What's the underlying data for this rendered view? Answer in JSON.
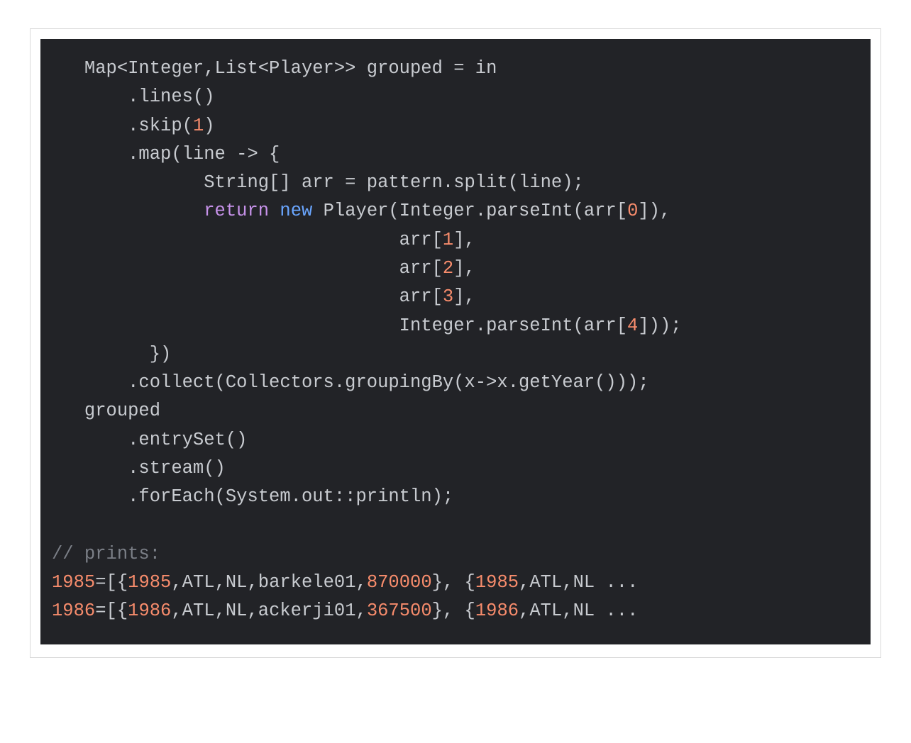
{
  "code": {
    "l1a": "   Map<Integer,List<Player>> grouped = in",
    "l2a": "       .lines()",
    "l3a": "       .skip(",
    "l3n": "1",
    "l3b": ")",
    "l4a": "       .map(line -> {",
    "l5a": "              String[] arr = pattern.split(line);",
    "l6a": "              ",
    "l6kw_return": "return",
    "l6sp": " ",
    "l6kw_new": "new",
    "l6b": " Player(Integer.parseInt(arr[",
    "l6n": "0",
    "l6c": "]),",
    "l7a": "                                arr[",
    "l7n": "1",
    "l7b": "],",
    "l8a": "                                arr[",
    "l8n": "2",
    "l8b": "],",
    "l9a": "                                arr[",
    "l9n": "3",
    "l9b": "],",
    "l10a": "                                Integer.parseInt(arr[",
    "l10n": "4",
    "l10b": "]));",
    "l11a": "         })",
    "l12a": "       .collect(Collectors.groupingBy(x->x.getYear()));",
    "l13a": "   grouped",
    "l14a": "       .entrySet()",
    "l15a": "       .stream()",
    "l16a": "       .forEach(System.out::println);",
    "blank": "",
    "c1": "// prints:",
    "o1n1": "1985",
    "o1a": "=[{",
    "o1n2": "1985",
    "o1b": ",ATL,NL,barkele01,",
    "o1n3": "870000",
    "o1c": "}, {",
    "o1n4": "1985",
    "o1d": ",ATL,NL ...",
    "o2n1": "1986",
    "o2a": "=[{",
    "o2n2": "1986",
    "o2b": ",ATL,NL,ackerji01,",
    "o2n3": "367500",
    "o2c": "}, {",
    "o2n4": "1986",
    "o2d": ",ATL,NL ..."
  }
}
